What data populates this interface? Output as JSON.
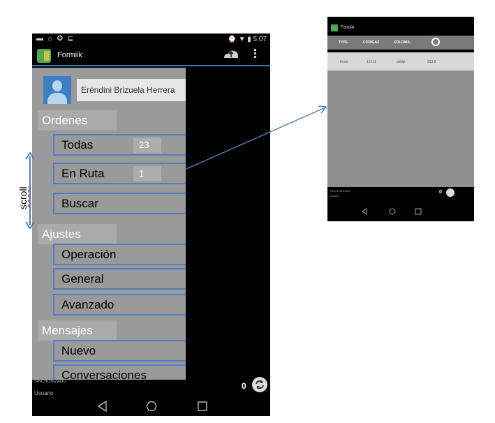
{
  "main_phone": {
    "status_time": "5:07",
    "app_title": "Formiik",
    "user_name": "Eréndini Brizuela Herrera",
    "sections": {
      "ordenes": {
        "title": "Ordenes",
        "items": [
          {
            "label": "Todas",
            "count": "23"
          },
          {
            "label": "En Ruta",
            "count": "1"
          },
          {
            "label": "Buscar"
          }
        ]
      },
      "ajustes": {
        "title": "Ajustes",
        "items": [
          {
            "label": "Operación"
          },
          {
            "label": "General"
          },
          {
            "label": "Avanzado"
          }
        ]
      },
      "mensajes": {
        "title": "Mensajes",
        "items": [
          {
            "label": "Nuevo"
          },
          {
            "label": "Conversaciones"
          }
        ]
      }
    },
    "bottom": {
      "sync_label": "SINCRONIZADO",
      "user_label": "Usuario",
      "pending_count": "0"
    }
  },
  "annotation": {
    "scroll_label": "scroll"
  },
  "small_phone": {
    "app_title": "Formiik",
    "columns": [
      "TYPE",
      "CODIGAZ",
      "COLONIA"
    ],
    "row": [
      "firma",
      "12131",
      "adkljk",
      "319.6"
    ],
    "sync_label": "SINCRONIZADO",
    "user_label": "Usuario",
    "pending_count": "0"
  },
  "colors": {
    "accent": "#4f7ec3",
    "drawer_bg": "#9a9a9a",
    "app_green": "#53a84d"
  }
}
